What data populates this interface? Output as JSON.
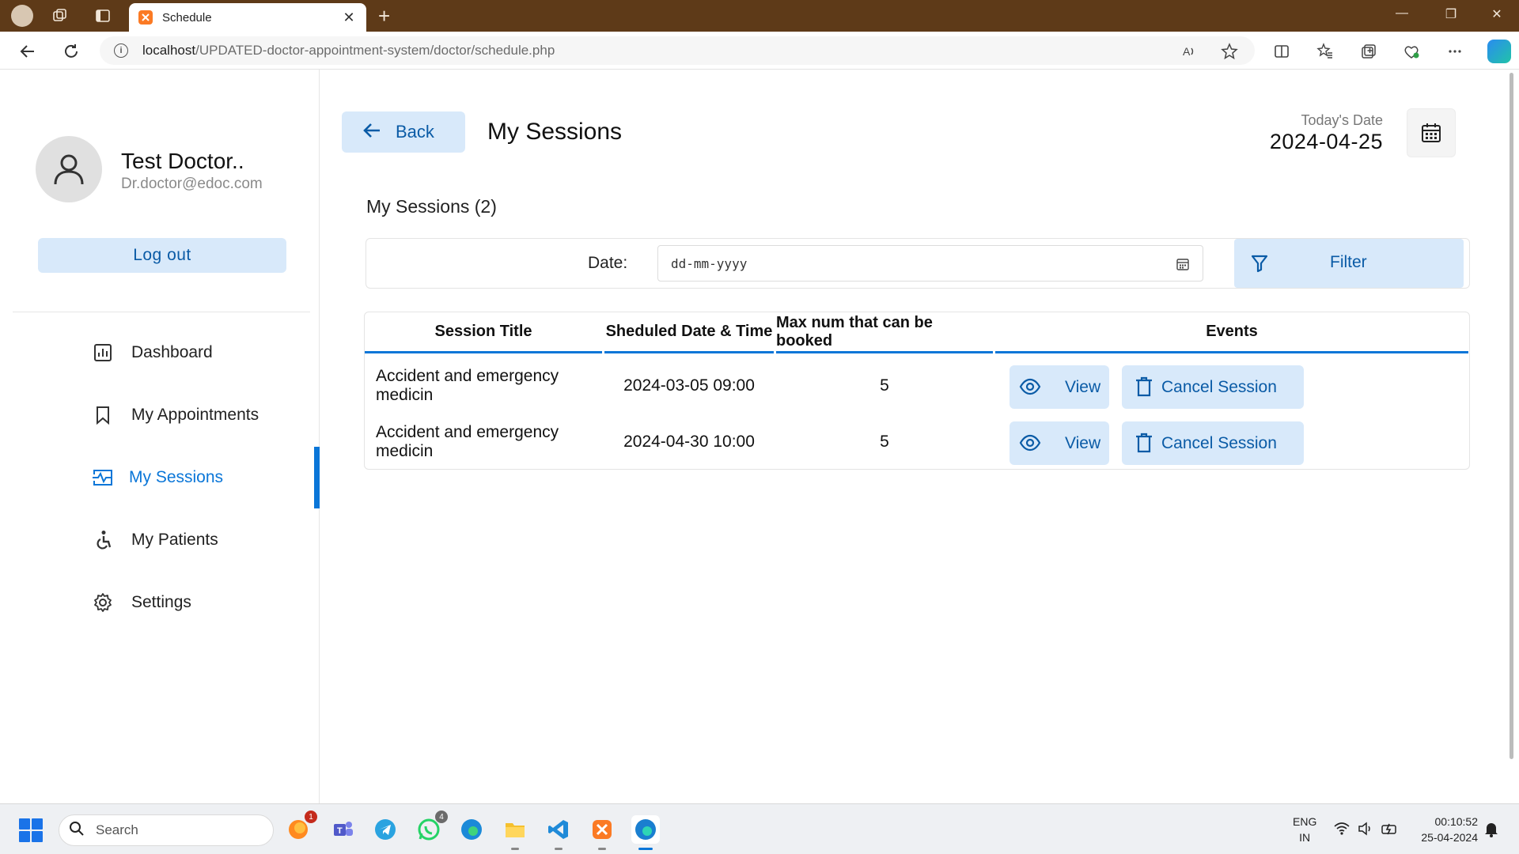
{
  "browser": {
    "tab_title": "Schedule",
    "url_host": "localhost",
    "url_path": "/UPDATED-doctor-appointment-system/doctor/schedule.php"
  },
  "sidebar": {
    "doctor_name": "Test Doctor..",
    "doctor_email": "Dr.doctor@edoc.com",
    "logout_label": "Log out",
    "items": [
      {
        "label": "Dashboard",
        "icon": "dashboard-icon",
        "active": false
      },
      {
        "label": "My Appointments",
        "icon": "bookmark-icon",
        "active": false
      },
      {
        "label": "My Sessions",
        "icon": "schedule-icon",
        "active": true
      },
      {
        "label": "My Patients",
        "icon": "patient-icon",
        "active": false
      },
      {
        "label": "Settings",
        "icon": "gear-icon",
        "active": false
      }
    ]
  },
  "header": {
    "back_label": "Back",
    "title": "My Sessions",
    "today_label": "Today's Date",
    "today_value": "2024-04-25"
  },
  "main": {
    "sessions_count": "My Sessions (2)",
    "filter": {
      "date_label": "Date:",
      "date_placeholder": "dd-mm-yyyy",
      "filter_label": "Filter"
    },
    "table": {
      "columns": [
        "Session Title",
        "Sheduled Date & Time",
        "Max num that can be booked",
        "Events"
      ],
      "rows": [
        {
          "title": "Accident and emergency medicin",
          "datetime": "2024-03-05 09:00",
          "max": "5",
          "view_label": "View",
          "cancel_label": "Cancel Session"
        },
        {
          "title": "Accident and emergency medicin",
          "datetime": "2024-04-30 10:00",
          "max": "5",
          "view_label": "View",
          "cancel_label": "Cancel Session"
        }
      ]
    }
  },
  "taskbar": {
    "search_label": "Search",
    "lang_top": "ENG",
    "lang_bottom": "IN",
    "time": "00:10:52",
    "date": "25-04-2024",
    "badges": {
      "firefox": "1",
      "whatsapp": "4"
    }
  },
  "colors": {
    "accent": "#0a76d8",
    "button_bg": "#d8e9fa",
    "titlebar": "#5e3a18"
  }
}
